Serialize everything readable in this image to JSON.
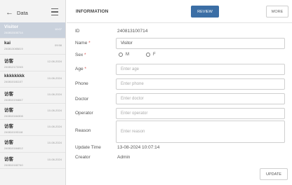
{
  "sidebar": {
    "title": "Data",
    "items": [
      {
        "name": "Visitor",
        "sub": "240813100714",
        "time": "10:07"
      },
      {
        "name": "kai",
        "sub": "240813085819",
        "time": "09:58"
      },
      {
        "name": "访客",
        "sub": "240812172245",
        "time": "12-08-2024"
      },
      {
        "name": "kkkkkkkk",
        "sub": "240810181107",
        "time": "10-08-2024"
      },
      {
        "name": "访客",
        "sub": "240810194847",
        "time": "10-08-2024"
      },
      {
        "name": "访客",
        "sub": "240810184308",
        "time": "10-08-2024"
      },
      {
        "name": "访客",
        "sub": "240810193118",
        "time": "10-08-2024"
      },
      {
        "name": "访客",
        "sub": "240810184812",
        "time": "10-08-2024"
      },
      {
        "name": "访客",
        "sub": "240810182740",
        "time": "10-08-2024"
      }
    ]
  },
  "header": {
    "title": "INFORMATION",
    "review_label": "REVIEW",
    "more_label": "MORE"
  },
  "form": {
    "id_label": "ID",
    "id_value": "240813100714",
    "name_label": "Name",
    "name_value": "Visitor",
    "sex_label": "Sex",
    "sex_options": [
      "M",
      "F"
    ],
    "age_label": "Age",
    "age_placeholder": "Enter age",
    "phone_label": "Phone",
    "phone_placeholder": "Enter phone",
    "doctor_label": "Doctor",
    "doctor_placeholder": "Enter doctor",
    "operator_label": "Operator",
    "operator_placeholder": "Enter operator",
    "reason_label": "Reason",
    "reason_placeholder": "Enter reason",
    "update_time_label": "Update Time",
    "update_time_value": "13-08-2024 10:07:14",
    "creator_label": "Creator",
    "creator_value": "Admin",
    "required_mark": "*"
  },
  "footer": {
    "update_label": "UPDATE"
  },
  "colors": {
    "accent": "#3b6ea5",
    "active_item": "#c9d1dc",
    "required": "#d9534f"
  }
}
